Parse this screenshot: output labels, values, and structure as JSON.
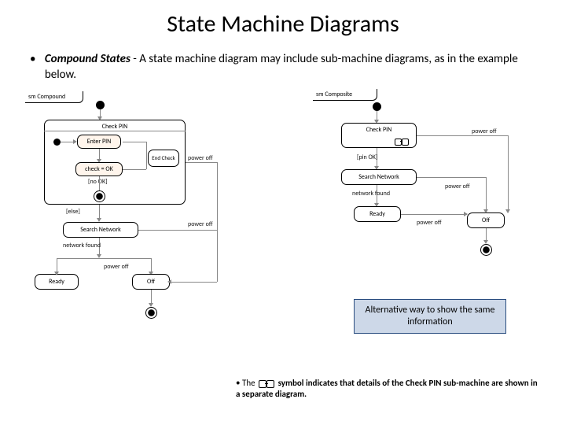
{
  "title": "State Machine Diagrams",
  "bullet": {
    "key": "Compound States",
    "text": " - A state machine diagram may include sub-machine diagrams, as in the example below."
  },
  "left_diagram": {
    "label": "sm Compound",
    "states": {
      "check_pin": "Check PIN",
      "enter_pin": "Enter PIN",
      "check_ok": "check = OK",
      "end_check": "End Check",
      "search_network": "Search Network",
      "ready": "Ready",
      "off": "Off"
    },
    "guards": {
      "no_ok": "[no OK]",
      "else2": "[else]"
    },
    "transitions": {
      "network_found": "network found",
      "power_off1": "power off",
      "power_off2": "power off",
      "power_off3": "power off"
    }
  },
  "right_diagram": {
    "label": "sm Composite",
    "states": {
      "check_pin": "Check PIN",
      "search_network": "Search Network",
      "ready": "Ready",
      "off": "Off"
    },
    "guards": {
      "pin_ok": "[pin OK]"
    },
    "transitions": {
      "network_found": "network found",
      "power_off1": "power off",
      "power_off2": "power off",
      "power_off3": "power off"
    }
  },
  "callout": "Alternative way to show the same information",
  "footnote_pre": "The ",
  "footnote_post": " symbol indicates that details of the Check PIN sub-machine are shown in a separate diagram."
}
